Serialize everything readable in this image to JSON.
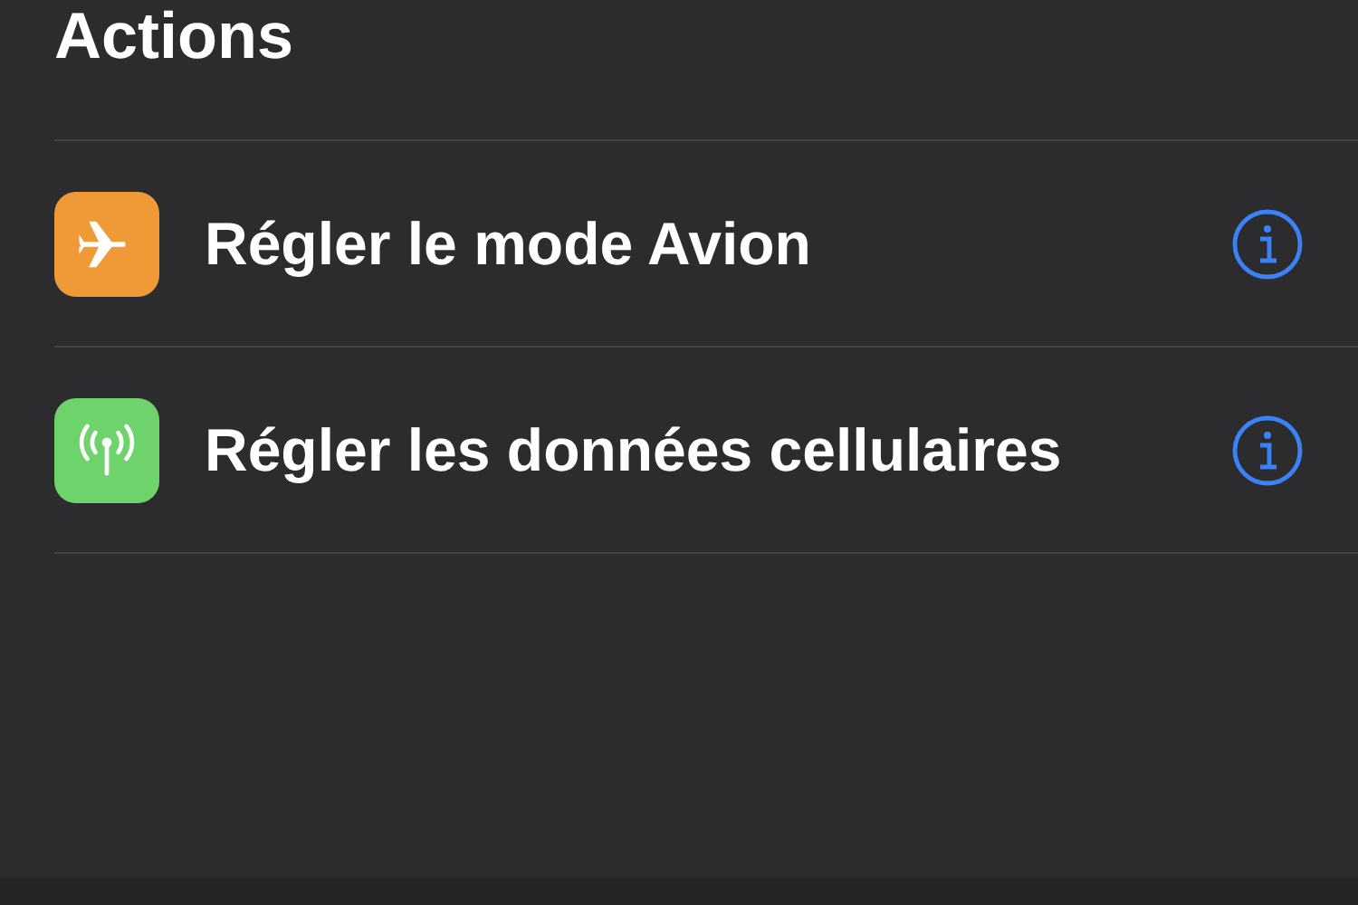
{
  "section": {
    "title": "Actions"
  },
  "actions": [
    {
      "kind": "airplane",
      "label": "Régler le mode Avion",
      "color": "#f09a37"
    },
    {
      "kind": "cellular",
      "label": "Régler les données cellulaires",
      "color": "#6fd36b"
    }
  ]
}
